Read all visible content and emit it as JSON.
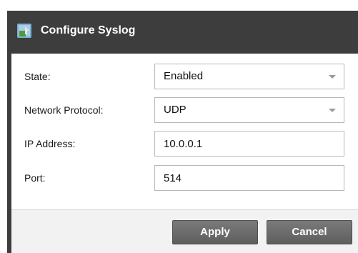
{
  "dialog": {
    "title": "Configure Syslog",
    "icon": "syslog-config-icon"
  },
  "form": {
    "state": {
      "label": "State:",
      "value": "Enabled"
    },
    "protocol": {
      "label": "Network Protocol:",
      "value": "UDP"
    },
    "ip_address": {
      "label": "IP Address:",
      "value": "10.0.0.1"
    },
    "port": {
      "label": "Port:",
      "value": "514"
    }
  },
  "buttons": {
    "apply_label": "Apply",
    "cancel_label": "Cancel"
  },
  "colors": {
    "titlebar_bg": "#3d3d3d",
    "button_bg": "#6b6b6b",
    "panel_bg": "#ffffff",
    "footer_bg": "#f2f2f2"
  }
}
